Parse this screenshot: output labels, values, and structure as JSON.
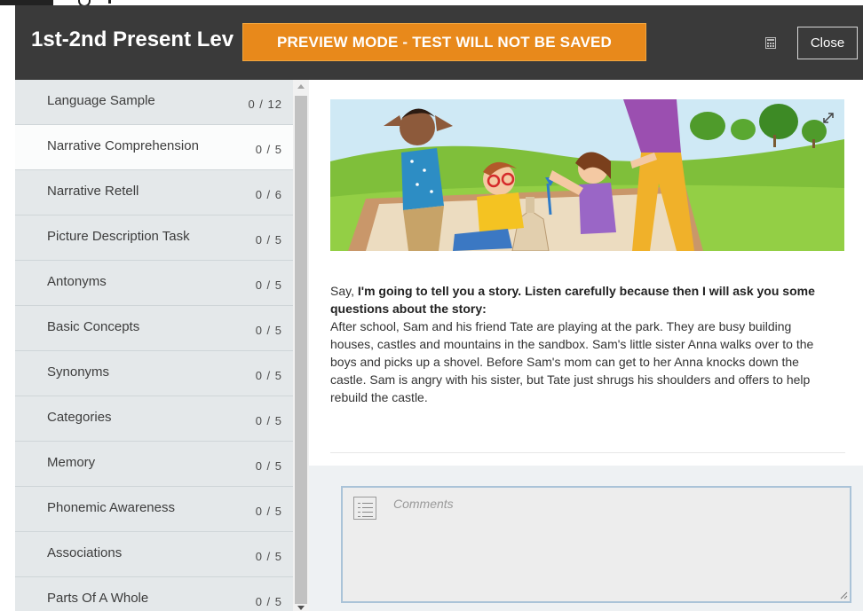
{
  "header": {
    "title": "1st-2nd Present Lev",
    "preview_banner": "PREVIEW MODE - TEST WILL NOT BE SAVED",
    "close_label": "Close"
  },
  "sidebar": {
    "items": [
      {
        "label": "Language Sample",
        "count": "0 / 12"
      },
      {
        "label": "Narrative Comprehension",
        "count": "0 / 5"
      },
      {
        "label": "Narrative Retell",
        "count": "0 / 6"
      },
      {
        "label": "Picture Description Task",
        "count": "0 / 5"
      },
      {
        "label": "Antonyms",
        "count": "0 / 5"
      },
      {
        "label": "Basic Concepts",
        "count": "0 / 5"
      },
      {
        "label": "Synonyms",
        "count": "0 / 5"
      },
      {
        "label": "Categories",
        "count": "0 / 5"
      },
      {
        "label": "Memory",
        "count": "0 / 5"
      },
      {
        "label": "Phonemic Awareness",
        "count": "0 / 5"
      },
      {
        "label": "Associations",
        "count": "0 / 5"
      },
      {
        "label": "Parts Of A Whole",
        "count": "0 / 5"
      }
    ],
    "active_index": 1
  },
  "content": {
    "say_prefix": "Say, ",
    "say_bold": "I'm going to tell you a story. Listen carefully because then I will ask you some questions about the story:",
    "story": "After school, Sam and his friend Tate are playing at the park. They are busy building houses, castles and mountains in the sandbox. Sam's little sister Anna walks over to the boys and picks up a shovel. Before Sam's mom can get to her Anna knocks down the castle. Sam is angry with his sister, but Tate just shrugs his shoulders and offers to help rebuild the castle."
  },
  "comments": {
    "placeholder": "Comments"
  },
  "colors": {
    "header_bg": "#3a3a3a",
    "banner_orange": "#e8891b",
    "sidebar_bg": "#e4e8ea",
    "active_item_bg": "#fbfcfc"
  },
  "icons": [
    "calculator-icon",
    "expand-icon",
    "comments-list-icon",
    "resize-grip-icon"
  ]
}
